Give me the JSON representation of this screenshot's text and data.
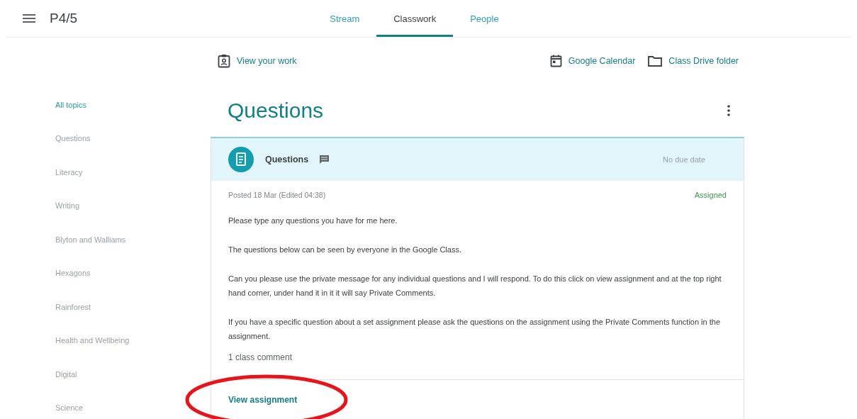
{
  "header": {
    "class_name": "P4/5",
    "tabs": [
      {
        "label": "Stream",
        "selected": false
      },
      {
        "label": "Classwork",
        "selected": true
      },
      {
        "label": "People",
        "selected": false
      }
    ]
  },
  "toolbar": {
    "view_work": "View your work",
    "links": [
      "Google Calendar",
      "Class Drive folder"
    ]
  },
  "sidebar": {
    "items": [
      {
        "label": "All topics",
        "selected": true
      },
      {
        "label": "Questions",
        "selected": false
      },
      {
        "label": "Literacy",
        "selected": false
      },
      {
        "label": "Writing",
        "selected": false
      },
      {
        "label": "Blyton and Walliams",
        "selected": false
      },
      {
        "label": "Hexagons",
        "selected": false
      },
      {
        "label": "Rainforest",
        "selected": false
      },
      {
        "label": "Health and Wellbeing",
        "selected": false
      },
      {
        "label": "Digital",
        "selected": false
      },
      {
        "label": "Science",
        "selected": false
      }
    ]
  },
  "topic": {
    "title": "Questions"
  },
  "assignment": {
    "title": "Questions",
    "due": "No due date",
    "posted": "Posted 18 Mar (Edited 04:38)",
    "status": "Assigned",
    "paragraphs": [
      "Please type any questions you have for me here.",
      "The questions below can be seen by everyone in the Google Class.",
      "Can you please use the private message for any individual questions and I will respond. To do this click on view assignment and at the top right hand corner, under hand it in it it will say Private Comments.",
      "If you have a specific question about a set assignment please ask the questions on the assignment using the Private Comments function in the assignment."
    ],
    "comments": "1 class comment",
    "action": "View assignment"
  },
  "annotations": [
    {
      "kind": "ellipse",
      "color": "#e8141b"
    }
  ]
}
